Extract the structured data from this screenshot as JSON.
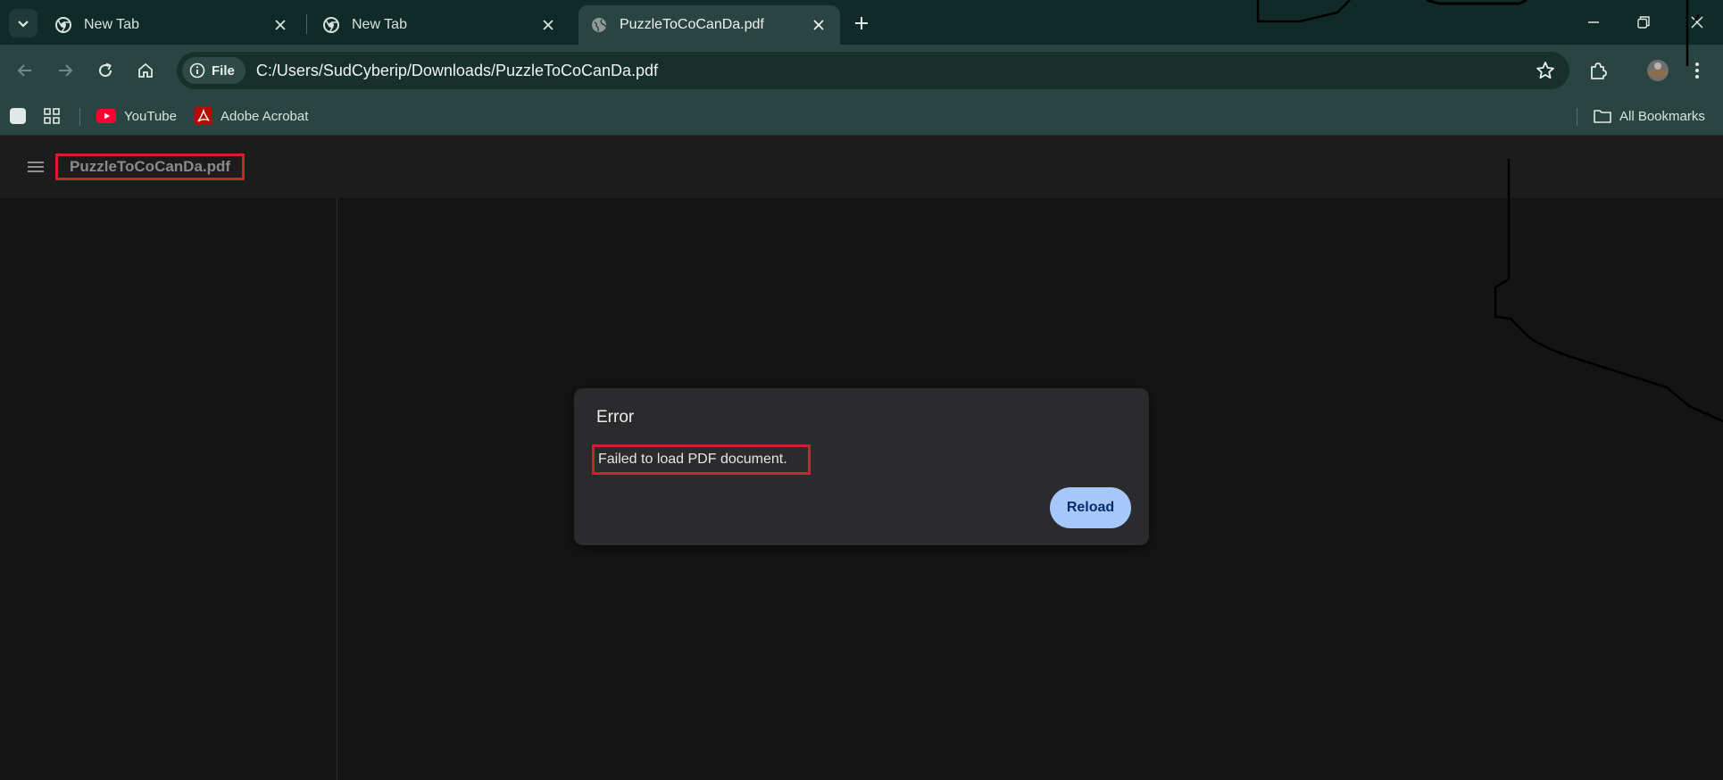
{
  "browser": {
    "tabs": [
      {
        "title": "New Tab",
        "favicon": "chrome-icon",
        "active": false
      },
      {
        "title": "New Tab",
        "favicon": "chrome-icon",
        "active": false
      },
      {
        "title": "PuzzleToCoCanDa.pdf",
        "favicon": "globe-icon",
        "active": true
      }
    ],
    "address_bar": {
      "chip_label": "File",
      "url": "C:/Users/SudCyberip/Downloads/PuzzleToCoCanDa.pdf"
    },
    "bookmarks": [
      {
        "label": "YouTube",
        "icon": "youtube-icon"
      },
      {
        "label": "Adobe Acrobat",
        "icon": "acrobat-icon"
      }
    ],
    "all_bookmarks_label": "All Bookmarks"
  },
  "viewer": {
    "document_title": "PuzzleToCoCanDa.pdf"
  },
  "dialog": {
    "title": "Error",
    "message": "Failed to load PDF document.",
    "button_label": "Reload"
  },
  "colors": {
    "tabstrip": "#0f2a27",
    "toolbar": "#2a4541",
    "viewer_bg": "#141414",
    "dialog_bg": "#2b2b2e",
    "reload_button": "#a8c7fa",
    "highlight_box": "#d0202e"
  }
}
